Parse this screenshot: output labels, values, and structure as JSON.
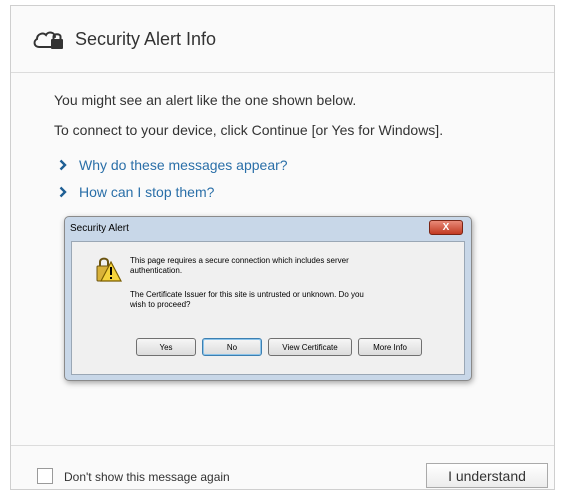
{
  "header": {
    "title": "Security Alert Info",
    "icon": "cloud-lock-icon"
  },
  "body": {
    "line1": "You might see an alert like the one shown below.",
    "line2": "To connect to your device, click Continue [or Yes for Windows].",
    "links": [
      {
        "label": "Why do these messages appear?",
        "icon": "chevron-right-icon"
      },
      {
        "label": "How can I stop them?",
        "icon": "chevron-right-icon"
      }
    ]
  },
  "example_dialog": {
    "title": "Security Alert",
    "close_label": "X",
    "icon": "warning-lock-icon",
    "message1": "This page requires a secure connection which includes server authentication.",
    "message2": "The Certificate Issuer for this site is untrusted or unknown.  Do you wish to proceed?",
    "buttons": {
      "yes": "Yes",
      "no": "No",
      "view": "View Certificate",
      "more": "More Info"
    }
  },
  "footer": {
    "checkbox_label": "Don't show this message again",
    "checkbox_checked": false,
    "button_label": "I understand"
  },
  "colors": {
    "link": "#2a6fa8",
    "dialog_bg": "#fafafa"
  }
}
